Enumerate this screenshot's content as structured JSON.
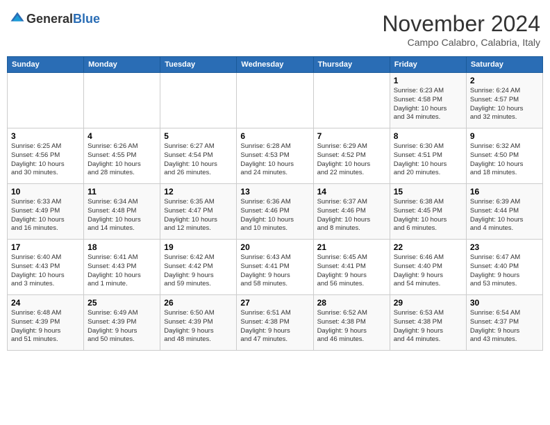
{
  "header": {
    "logo_general": "General",
    "logo_blue": "Blue",
    "month_title": "November 2024",
    "location": "Campo Calabro, Calabria, Italy"
  },
  "days_of_week": [
    "Sunday",
    "Monday",
    "Tuesday",
    "Wednesday",
    "Thursday",
    "Friday",
    "Saturday"
  ],
  "weeks": [
    [
      {
        "day": "",
        "info": ""
      },
      {
        "day": "",
        "info": ""
      },
      {
        "day": "",
        "info": ""
      },
      {
        "day": "",
        "info": ""
      },
      {
        "day": "",
        "info": ""
      },
      {
        "day": "1",
        "info": "Sunrise: 6:23 AM\nSunset: 4:58 PM\nDaylight: 10 hours\nand 34 minutes."
      },
      {
        "day": "2",
        "info": "Sunrise: 6:24 AM\nSunset: 4:57 PM\nDaylight: 10 hours\nand 32 minutes."
      }
    ],
    [
      {
        "day": "3",
        "info": "Sunrise: 6:25 AM\nSunset: 4:56 PM\nDaylight: 10 hours\nand 30 minutes."
      },
      {
        "day": "4",
        "info": "Sunrise: 6:26 AM\nSunset: 4:55 PM\nDaylight: 10 hours\nand 28 minutes."
      },
      {
        "day": "5",
        "info": "Sunrise: 6:27 AM\nSunset: 4:54 PM\nDaylight: 10 hours\nand 26 minutes."
      },
      {
        "day": "6",
        "info": "Sunrise: 6:28 AM\nSunset: 4:53 PM\nDaylight: 10 hours\nand 24 minutes."
      },
      {
        "day": "7",
        "info": "Sunrise: 6:29 AM\nSunset: 4:52 PM\nDaylight: 10 hours\nand 22 minutes."
      },
      {
        "day": "8",
        "info": "Sunrise: 6:30 AM\nSunset: 4:51 PM\nDaylight: 10 hours\nand 20 minutes."
      },
      {
        "day": "9",
        "info": "Sunrise: 6:32 AM\nSunset: 4:50 PM\nDaylight: 10 hours\nand 18 minutes."
      }
    ],
    [
      {
        "day": "10",
        "info": "Sunrise: 6:33 AM\nSunset: 4:49 PM\nDaylight: 10 hours\nand 16 minutes."
      },
      {
        "day": "11",
        "info": "Sunrise: 6:34 AM\nSunset: 4:48 PM\nDaylight: 10 hours\nand 14 minutes."
      },
      {
        "day": "12",
        "info": "Sunrise: 6:35 AM\nSunset: 4:47 PM\nDaylight: 10 hours\nand 12 minutes."
      },
      {
        "day": "13",
        "info": "Sunrise: 6:36 AM\nSunset: 4:46 PM\nDaylight: 10 hours\nand 10 minutes."
      },
      {
        "day": "14",
        "info": "Sunrise: 6:37 AM\nSunset: 4:46 PM\nDaylight: 10 hours\nand 8 minutes."
      },
      {
        "day": "15",
        "info": "Sunrise: 6:38 AM\nSunset: 4:45 PM\nDaylight: 10 hours\nand 6 minutes."
      },
      {
        "day": "16",
        "info": "Sunrise: 6:39 AM\nSunset: 4:44 PM\nDaylight: 10 hours\nand 4 minutes."
      }
    ],
    [
      {
        "day": "17",
        "info": "Sunrise: 6:40 AM\nSunset: 4:43 PM\nDaylight: 10 hours\nand 3 minutes."
      },
      {
        "day": "18",
        "info": "Sunrise: 6:41 AM\nSunset: 4:43 PM\nDaylight: 10 hours\nand 1 minute."
      },
      {
        "day": "19",
        "info": "Sunrise: 6:42 AM\nSunset: 4:42 PM\nDaylight: 9 hours\nand 59 minutes."
      },
      {
        "day": "20",
        "info": "Sunrise: 6:43 AM\nSunset: 4:41 PM\nDaylight: 9 hours\nand 58 minutes."
      },
      {
        "day": "21",
        "info": "Sunrise: 6:45 AM\nSunset: 4:41 PM\nDaylight: 9 hours\nand 56 minutes."
      },
      {
        "day": "22",
        "info": "Sunrise: 6:46 AM\nSunset: 4:40 PM\nDaylight: 9 hours\nand 54 minutes."
      },
      {
        "day": "23",
        "info": "Sunrise: 6:47 AM\nSunset: 4:40 PM\nDaylight: 9 hours\nand 53 minutes."
      }
    ],
    [
      {
        "day": "24",
        "info": "Sunrise: 6:48 AM\nSunset: 4:39 PM\nDaylight: 9 hours\nand 51 minutes."
      },
      {
        "day": "25",
        "info": "Sunrise: 6:49 AM\nSunset: 4:39 PM\nDaylight: 9 hours\nand 50 minutes."
      },
      {
        "day": "26",
        "info": "Sunrise: 6:50 AM\nSunset: 4:39 PM\nDaylight: 9 hours\nand 48 minutes."
      },
      {
        "day": "27",
        "info": "Sunrise: 6:51 AM\nSunset: 4:38 PM\nDaylight: 9 hours\nand 47 minutes."
      },
      {
        "day": "28",
        "info": "Sunrise: 6:52 AM\nSunset: 4:38 PM\nDaylight: 9 hours\nand 46 minutes."
      },
      {
        "day": "29",
        "info": "Sunrise: 6:53 AM\nSunset: 4:38 PM\nDaylight: 9 hours\nand 44 minutes."
      },
      {
        "day": "30",
        "info": "Sunrise: 6:54 AM\nSunset: 4:37 PM\nDaylight: 9 hours\nand 43 minutes."
      }
    ]
  ]
}
